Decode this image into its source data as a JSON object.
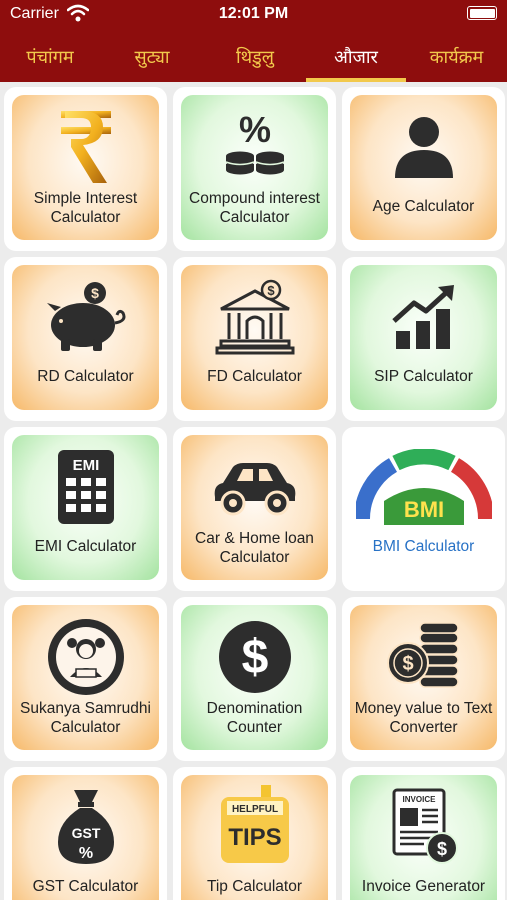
{
  "status_bar": {
    "carrier": "Carrier",
    "time": "12:01 PM"
  },
  "tabs": [
    {
      "label": "पंचांगम"
    },
    {
      "label": "सुट्या"
    },
    {
      "label": "थिडुलु"
    },
    {
      "label": "औजार"
    },
    {
      "label": "कार्यक्रम"
    }
  ],
  "active_tab": "औजार",
  "colors": {
    "brand": "#8e0d0d",
    "tab_text": "#f2c94c",
    "active_tab_text": "#ffffff"
  },
  "tools": [
    {
      "label": "Simple Interest Calculator",
      "icon": "rupee-icon"
    },
    {
      "label": "Compound interest Calculator",
      "icon": "percent-coins-icon"
    },
    {
      "label": "Age Calculator",
      "icon": "person-icon"
    },
    {
      "label": "RD Calculator",
      "icon": "piggy-bank-icon"
    },
    {
      "label": "FD Calculator",
      "icon": "bank-icon"
    },
    {
      "label": "SIP Calculator",
      "icon": "growth-chart-icon"
    },
    {
      "label": "EMI Calculator",
      "icon": "emi-calculator-icon",
      "icon_text": "EMI"
    },
    {
      "label": "Car & Home loan Calculator",
      "icon": "car-icon"
    },
    {
      "label": "BMI Calculator",
      "icon": "bmi-gauge-icon",
      "icon_text": "BMI"
    },
    {
      "label": "Sukanya Samrudhi Calculator",
      "icon": "girl-child-icon"
    },
    {
      "label": "Denomination Counter",
      "icon": "dollar-coin-icon"
    },
    {
      "label": "Money value to Text Converter",
      "icon": "coins-stack-icon"
    },
    {
      "label": "GST Calculator",
      "icon": "gst-bag-icon",
      "icon_text": "GST"
    },
    {
      "label": "Tip Calculator",
      "icon": "helpful-tips-icon",
      "icon_text_1": "HELPFUL",
      "icon_text_2": "TIPS"
    },
    {
      "label": "Invoice Generator",
      "icon": "invoice-icon",
      "icon_text": "INVOICE"
    }
  ]
}
